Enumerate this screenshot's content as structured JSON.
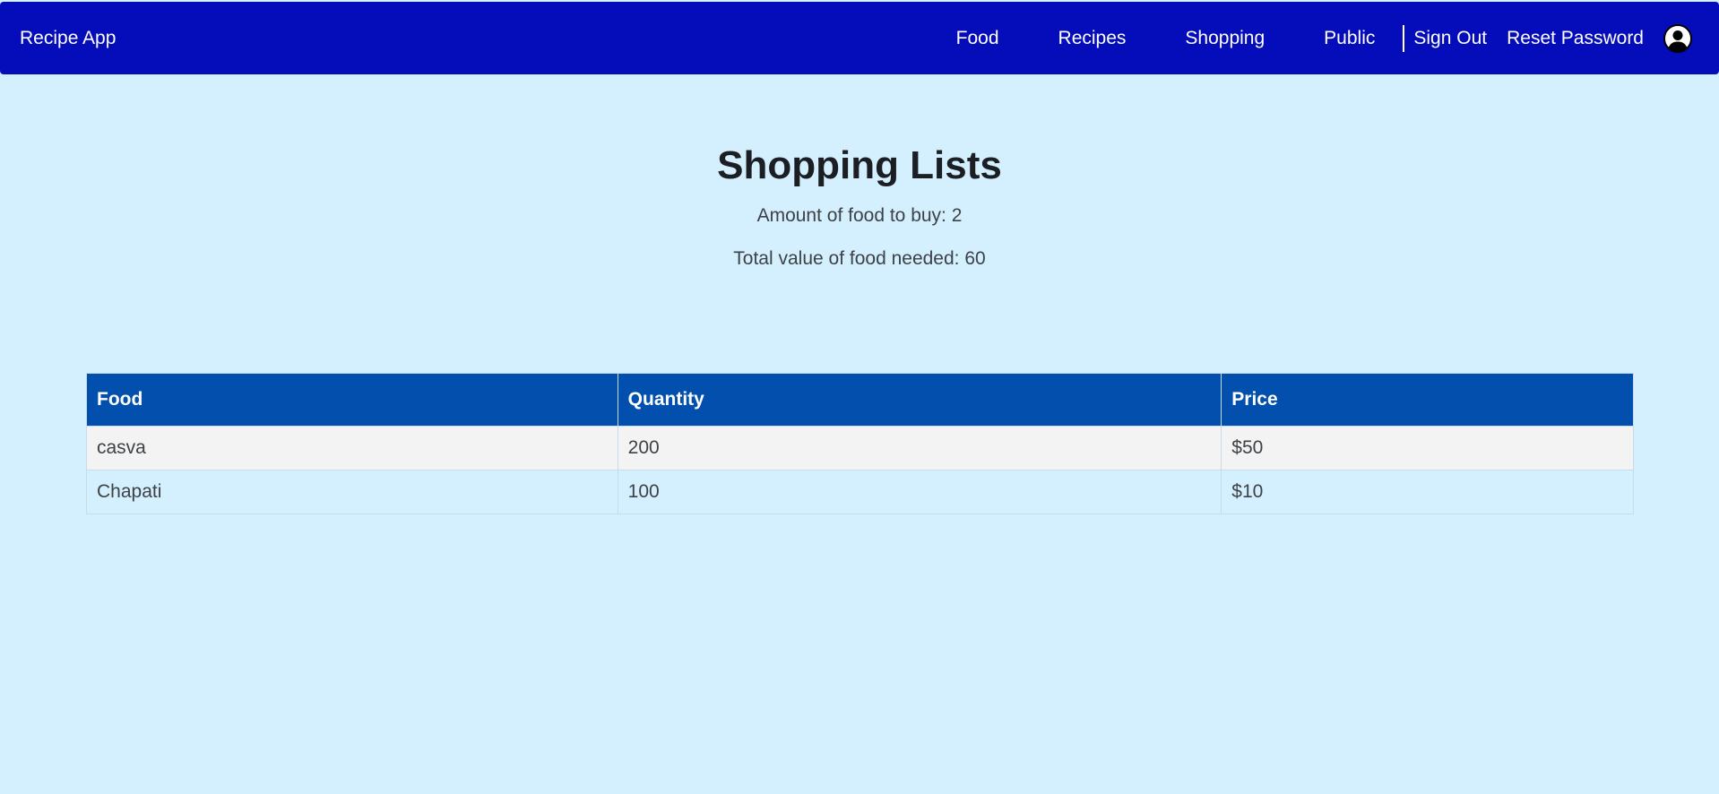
{
  "navbar": {
    "brand": "Recipe App",
    "links": {
      "food": "Food",
      "recipes": "Recipes",
      "shopping": "Shopping",
      "public": "Public",
      "sign_out": "Sign Out",
      "reset_password": "Reset Password"
    },
    "avatar_icon": "user-avatar-icon",
    "background_color": "#050dbb"
  },
  "main": {
    "title": "Shopping Lists",
    "amount_label": "Amount of food to buy: 2",
    "total_label": "Total value of food needed: 60",
    "table": {
      "headers": {
        "food": "Food",
        "quantity": "Quantity",
        "price": "Price"
      },
      "rows": [
        {
          "food": "casva",
          "quantity": "200",
          "price": "$50"
        },
        {
          "food": "Chapati",
          "quantity": "100",
          "price": "$10"
        }
      ],
      "header_color": "#034fad"
    }
  },
  "page_background": "#d4effe"
}
